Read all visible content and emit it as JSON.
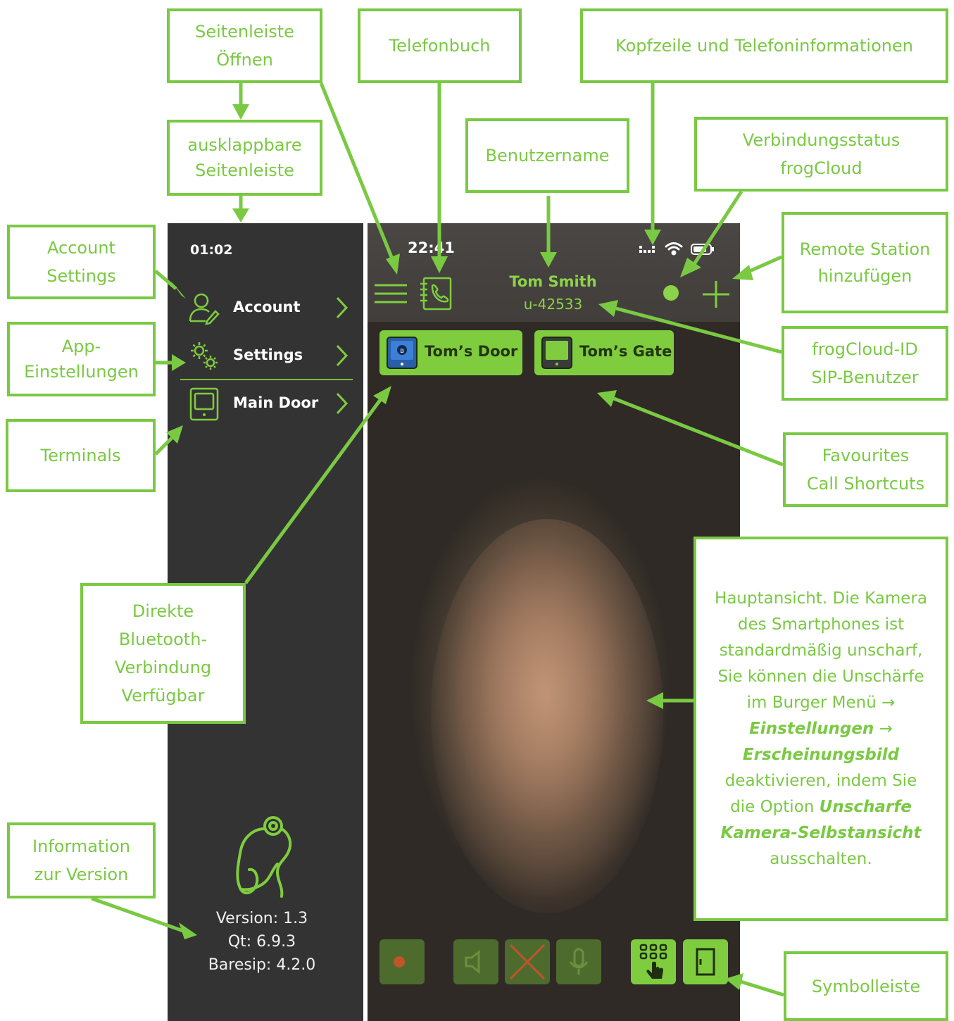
{
  "sidebar": {
    "time": "01:02",
    "items": [
      {
        "label": "Account",
        "icon": "user-edit-icon"
      },
      {
        "label": "Settings",
        "icon": "gears-icon"
      },
      {
        "label": "Main Door",
        "icon": "terminal-icon"
      }
    ],
    "logo_icon": "frog-logo-icon",
    "version": "Version: 1.3",
    "qt": "Qt: 6.9.3",
    "baresip": "Baresip: 4.2.0"
  },
  "phone": {
    "time": "22:41",
    "user_name": "Tom Smith",
    "user_id": "u-42533",
    "favourites": [
      {
        "label": "Tom’s Door",
        "icon": "bluetooth-terminal-icon"
      },
      {
        "label": "Tom’s Gate",
        "icon": "terminal-icon"
      }
    ],
    "toolbar": [
      "record-icon",
      "speaker-icon",
      "hangup-icon",
      "microphone-icon",
      "keypad-icon",
      "door-icon"
    ]
  },
  "annotations": {
    "open_sidebar": "Seitenleiste\nÖffnen",
    "foldout_sidebar": "ausklappbare\nSeitenleiste",
    "phonebook": "Telefonbuch",
    "header_info": "Kopfzeile und Telefoninformationen",
    "username": "Benutzername",
    "connection_status": "Verbindungsstatus\nfrogCloud",
    "account_settings": "Account\nSettings",
    "remote_station": "Remote Station\nhinzufügen",
    "app_settings": "App-\nEinstellungen",
    "frogcloud_id": "frogCloud-ID\nSIP-Benutzer",
    "terminals": "Terminals",
    "favourites": "Favourites\nCall Shortcuts",
    "bluetooth": "Direkte\nBluetooth-\nVerbindung\nVerfügbar",
    "main_view": {
      "l1": "Hauptansicht. Die Kamera",
      "l2": "des Smartphones ist",
      "l3": "standardmäßig unscharf,",
      "l4": "Sie können die Unschärfe",
      "l5": "im Burger Menü →",
      "l6": "Einstellungen",
      "l6b": " →",
      "l7": "Erscheinungsbild",
      "l8": "deaktivieren, indem Sie",
      "l9a": "die Option ",
      "l9b": "Unscharfe",
      "l10": "Kamera-Selbstansicht",
      "l11": "ausschalten."
    },
    "version_info": "Information\nzur Version",
    "toolbar": "Symbolleiste"
  },
  "colors": {
    "accent": "#7ac943",
    "app_green": "#8cd24a",
    "sidebar_bg": "#333333"
  }
}
